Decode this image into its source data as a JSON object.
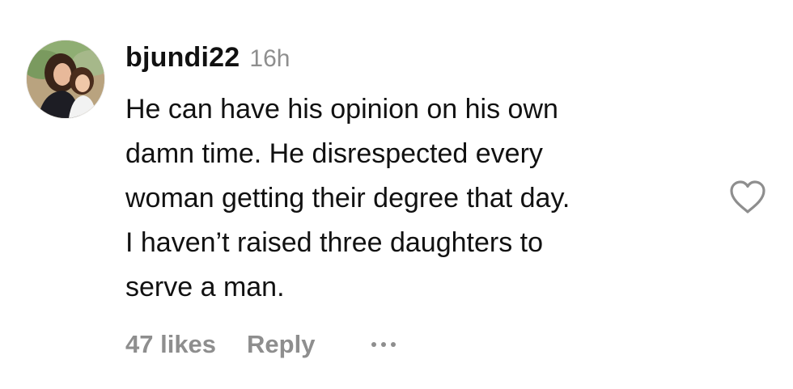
{
  "comment": {
    "username": "bjundi22",
    "timestamp": "16h",
    "lines": [
      "He can have his opinion on his own",
      "damn time. He disrespected every",
      "woman getting their degree that day.",
      "I haven’t raised three daughters to",
      "serve a man."
    ],
    "likes_label": "47 likes",
    "reply_label": "Reply",
    "more_icon": "more-horizontal-icon",
    "like_icon": "heart-outline-icon"
  },
  "colors": {
    "text_primary": "#111111",
    "text_secondary": "#8e8e8e",
    "icon_stroke": "#8e8e8e",
    "background": "#ffffff"
  }
}
